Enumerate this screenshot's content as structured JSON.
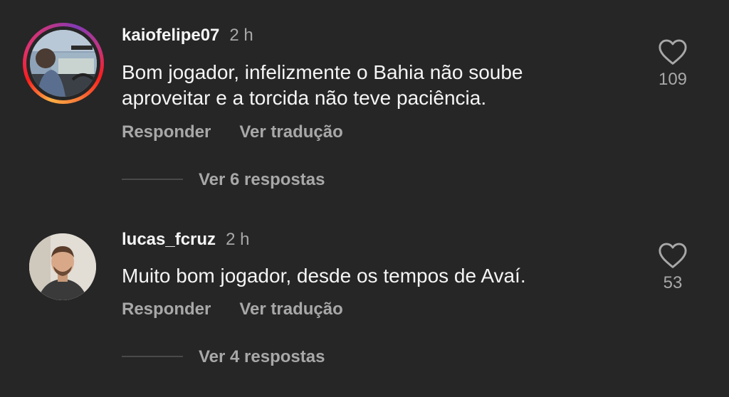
{
  "comments": [
    {
      "username": "kaiofelipe07",
      "time": "2 h",
      "text_line1": "Bom jogador, infelizmente o Bahia não soube",
      "text_line2": "aproveitar e a torcida não teve paciência.",
      "reply_label": "Responder",
      "translate_label": "Ver tradução",
      "view_replies": "Ver 6 respostas",
      "likes": "109",
      "icon": "heart-outline-icon",
      "has_story_ring": true
    },
    {
      "username": "lucas_fcruz",
      "time": "2 h",
      "text_line1": "Muito bom jogador, desde os tempos de Avaí.",
      "reply_label": "Responder",
      "translate_label": "Ver tradução",
      "view_replies": "Ver 4 respostas",
      "likes": "53",
      "icon": "heart-outline-icon",
      "has_story_ring": false
    }
  ],
  "colors": {
    "background": "#262626",
    "primary_text": "#f5f5f5",
    "secondary_text": "#a8a8a8"
  }
}
